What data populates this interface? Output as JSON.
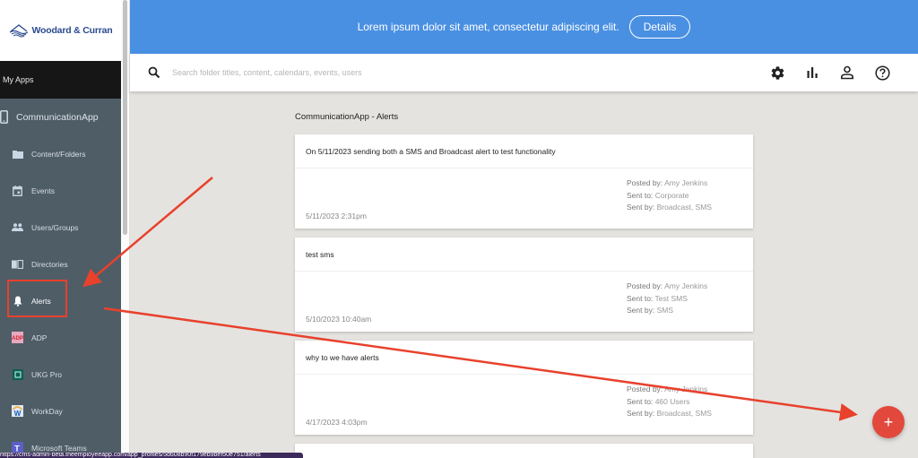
{
  "sidebar": {
    "logo": {
      "text": "Woodard & Curran"
    },
    "my_apps_label": "My Apps",
    "app_header": {
      "label": "CommunicationApp",
      "icon": "tablet-icon"
    },
    "items": [
      {
        "label": "Content/Folders",
        "icon": "folder-icon"
      },
      {
        "label": "Events",
        "icon": "calendar-icon"
      },
      {
        "label": "Users/Groups",
        "icon": "users-icon"
      },
      {
        "label": "Directories",
        "icon": "book-icon"
      },
      {
        "label": "Alerts",
        "icon": "bell-icon",
        "active": true
      },
      {
        "label": "ADP",
        "icon": "adp-logo-icon"
      },
      {
        "label": "UKG Pro",
        "icon": "ukg-logo-icon"
      },
      {
        "label": "WorkDay",
        "icon": "workday-logo-icon"
      },
      {
        "label": "Microsoft Teams",
        "icon": "teams-logo-icon"
      }
    ]
  },
  "banner": {
    "text": "Lorem ipsum dolor sit amet, consectetur adipiscing elit.",
    "button_label": "Details",
    "color": "#4a90e2"
  },
  "search": {
    "placeholder": "Search folder titles, content, calendars, events, users",
    "value": ""
  },
  "toolbar": {
    "icons": [
      "gear-icon",
      "bar-chart-icon",
      "user-icon",
      "help-icon"
    ]
  },
  "main": {
    "title": "CommunicationApp - Alerts",
    "labels": {
      "posted_by": "Posted by:",
      "sent_to": "Sent to:",
      "sent_by": "Sent by:"
    },
    "alerts": [
      {
        "title": "On 5/11/2023 sending both a SMS and Broadcast alert to test functionality",
        "date": "5/11/2023 2:31pm",
        "posted_by": "Amy Jenkins",
        "sent_to": "Corporate",
        "sent_by": "Broadcast, SMS"
      },
      {
        "title": "test sms",
        "date": "5/10/2023 10:40am",
        "posted_by": "Amy Jenkins",
        "sent_to": "Test SMS",
        "sent_by": "SMS"
      },
      {
        "title": "why to we have alerts",
        "date": "4/17/2023 4:03pm",
        "posted_by": "Amy Jenkins",
        "sent_to": "460 Users",
        "sent_by": "Broadcast, SMS"
      }
    ]
  },
  "fab": {
    "label": "+",
    "color": "#e2483b"
  },
  "status_bar": {
    "text": "https://cms-admin-beta.theemployeeapp.com/app_profiles/5d608b90f179eb9bef50e751/alerts"
  },
  "annotation_color": "#e8412c"
}
